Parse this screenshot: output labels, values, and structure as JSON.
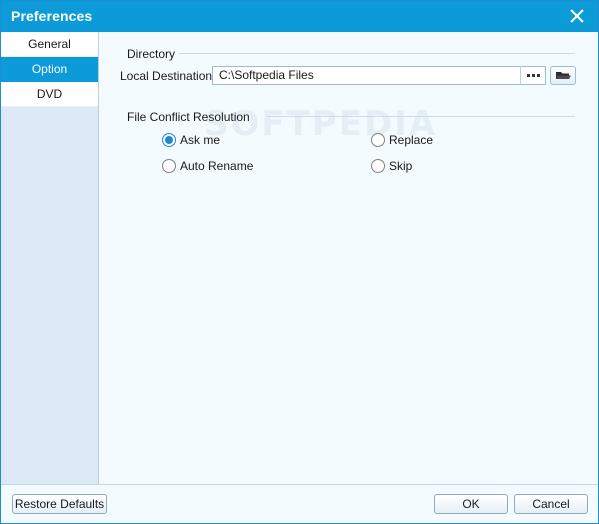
{
  "window": {
    "title": "Preferences",
    "close_icon": "close-icon"
  },
  "sidebar": {
    "items": [
      {
        "label": "General",
        "active": false
      },
      {
        "label": "Option",
        "active": true
      },
      {
        "label": "DVD",
        "active": false
      }
    ]
  },
  "directory": {
    "header": "Directory",
    "local_destination_label": "Local Destination:",
    "local_destination_value": "C:\\Softpedia Files",
    "browse_icon": "ellipsis-icon",
    "open_folder_icon": "folder-open-icon"
  },
  "conflict": {
    "header": "File Conflict Resolution",
    "options": [
      {
        "label": "Ask me",
        "checked": true
      },
      {
        "label": "Replace",
        "checked": false
      },
      {
        "label": "Auto Rename",
        "checked": false
      },
      {
        "label": "Skip",
        "checked": false
      }
    ]
  },
  "watermark": "SOFTPEDIA",
  "footer": {
    "restore_label": "Restore Defaults",
    "ok_label": "OK",
    "cancel_label": "Cancel"
  },
  "colors": {
    "accent": "#0C9AD8",
    "sidebar_bg": "#DDE9F6",
    "content_bg": "#F4FBFF"
  }
}
